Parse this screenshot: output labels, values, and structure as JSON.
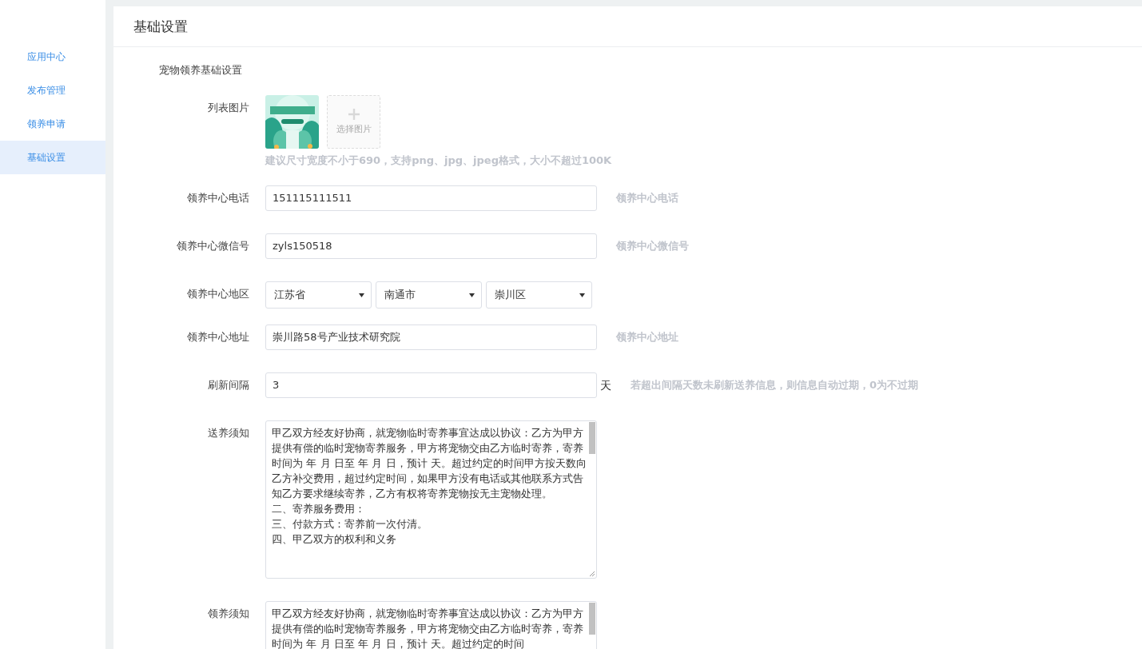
{
  "sidebar": {
    "items": [
      {
        "label": "应用中心",
        "selected": false
      },
      {
        "label": "发布管理",
        "selected": false
      },
      {
        "label": "领养申请",
        "selected": false
      },
      {
        "label": "基础设置",
        "selected": true
      }
    ]
  },
  "panel": {
    "title": "基础设置",
    "section_title": "宠物领养基础设置",
    "fields": [
      {
        "label": "列表图片",
        "add_label": "选择图片",
        "hint": "建议尺寸宽度不小于690，支持png、jpg、jpeg格式，大小不超过100K"
      },
      {
        "kind": "text",
        "label": "领养中心电话",
        "value": "151115111511",
        "hint": "领养中心电话"
      },
      {
        "kind": "text",
        "label": "领养中心微信号",
        "value": "zyls150518",
        "hint": "领养中心微信号"
      },
      {
        "kind": "region",
        "label": "领养中心地区",
        "selects": [
          "江苏省",
          "南通市",
          "崇川区"
        ]
      },
      {
        "kind": "text",
        "label": "领养中心地址",
        "value": "崇川路58号产业技术研究院",
        "hint": "领养中心地址"
      },
      {
        "kind": "text",
        "label": "刷新间隔",
        "value": "3",
        "unit": "天",
        "hint": "若超出间隔天数未刷新送养信息，则信息自动过期，0为不过期"
      },
      {
        "kind": "textarea",
        "label": "送养须知",
        "paragraphs": [
          "甲乙双方经友好协商，就宠物临时寄养事宜达成以协议：乙方为甲方提供有偿的临时宠物寄养服务，甲方将宠物交由乙方临时寄养，寄养时间为 年 月 日至 年 月 日，预计 天。超过约定的时间甲方按天数向乙方补交费用，超过约定时间，如果甲方没有电话或其他联系方式告知乙方要求继续寄养，乙方有权将寄养宠物按无主宠物处理。",
          "二、寄养服务费用：",
          "三、付款方式：寄养前一次付清。",
          "四、甲乙双方的权利和义务"
        ]
      },
      {
        "kind": "textarea",
        "label": "领养须知",
        "paragraphs": [
          "甲乙双方经友好协商，就宠物临时寄养事宜达成以协议：乙方为甲方提供有偿的临时宠物寄养服务，甲方将宠物交由乙方临时寄养，寄养时间为 年 月 日至 年 月 日，预计 天。超过约定的时间"
        ]
      }
    ]
  }
}
